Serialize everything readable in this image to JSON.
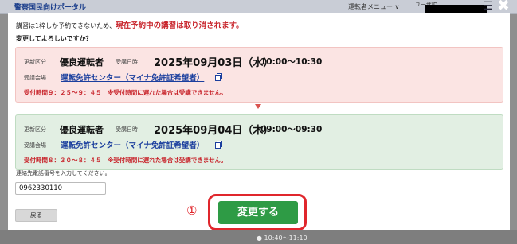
{
  "header": {
    "portal_title": "警察国民向けポータル",
    "driver_menu": "運転者メニュー ∨",
    "user_id_label": "ユーザID"
  },
  "modal": {
    "message_line1_prefix": "講習は1枠しか予約できないため、",
    "message_line1_red": "現在予約中の講習は取り消されます。",
    "message_line2": "変更してよろしいですか？",
    "current": {
      "category_label": "更新区分",
      "category": "優良運転者",
      "date_label": "受講日時",
      "date": "2025年09月03日（水）",
      "time": "10:00～10:30",
      "venue_label": "受講会場",
      "venue": "運転免許センター（マイナ免許証希望者）",
      "warning": "受付時間９：２５～９：４５　※受付時間に遅れた場合は受講できません。"
    },
    "new": {
      "category_label": "更新区分",
      "category": "優良運転者",
      "date_label": "受講日時",
      "date": "2025年09月04日（木）",
      "time": "09:00～09:30",
      "venue_label": "受講会場",
      "venue": "運転免許センター（マイナ免許証希望者）",
      "warning": "受付時間８：３０～８：４５　※受付時間に遅れた場合は受講できません。"
    },
    "phone_prompt": "連絡先電話番号を入力してください。",
    "phone_value": "0962330110",
    "back_button": "戻る",
    "step_marker": "①",
    "confirm_button": "変更する"
  },
  "background": {
    "bottom_time": "10:40～11:10"
  },
  "colors": {
    "accent_red": "#e0262c",
    "confirm_green": "#2e9b45",
    "link_blue": "#1b3f9e"
  }
}
